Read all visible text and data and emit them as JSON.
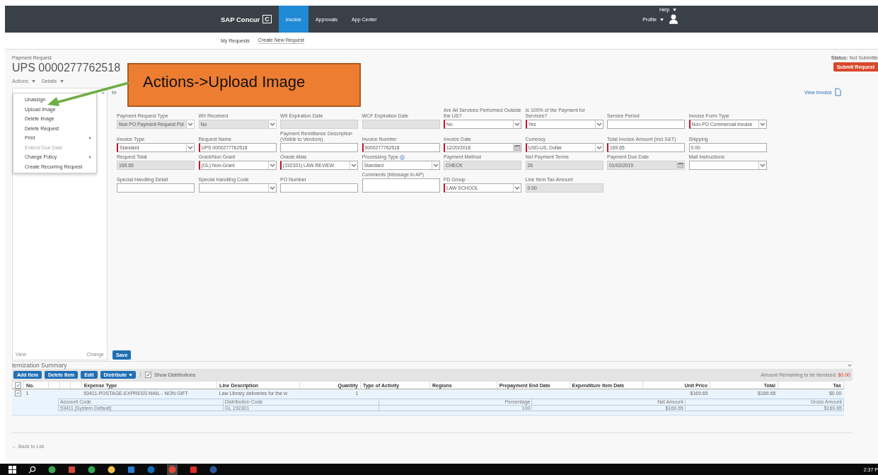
{
  "nav": {
    "brand": "SAP Concur",
    "brand_mark": "C",
    "help": "Help",
    "profile": "Profile",
    "tabs": [
      {
        "label": "Invoice",
        "selected": true
      },
      {
        "label": "Approvals",
        "selected": false
      },
      {
        "label": "App Center",
        "selected": false
      }
    ]
  },
  "subnav": [
    {
      "label": "My Requests",
      "selected": false
    },
    {
      "label": "Create New Request",
      "selected": true
    }
  ],
  "header": {
    "kicker": "Payment Request",
    "title": "UPS 0000277762518",
    "status_label": "Status:",
    "status_value": "Not Submitte",
    "submit": "Submit Request"
  },
  "menus": [
    "Actions",
    "Details"
  ],
  "actions_menu": [
    {
      "label": "Unassign",
      "disabled": false,
      "submenu": false
    },
    {
      "label": "Upload Image",
      "disabled": false,
      "submenu": false
    },
    {
      "label": "Delete Image",
      "disabled": false,
      "submenu": false
    },
    {
      "label": "Delete Request",
      "disabled": false,
      "submenu": false
    },
    {
      "label": "Print",
      "disabled": false,
      "submenu": true
    },
    {
      "label": "Extend Due Date",
      "disabled": true,
      "submenu": false
    },
    {
      "label": "Change Policy",
      "disabled": false,
      "submenu": true
    },
    {
      "label": "Create Recurring Request",
      "disabled": false,
      "submenu": false
    }
  ],
  "panel": {
    "collapse": "«",
    "view": "View",
    "change": "Change"
  },
  "form_tab": "In",
  "view_invoice": "View Invoice",
  "form_rows": [
    [
      {
        "label": "Payment Request Type",
        "kind": "select",
        "value": "Non PO Payment Request Pol",
        "required": false,
        "disabled": true
      },
      {
        "label": "W9 Received",
        "kind": "select",
        "value": "No",
        "required": false,
        "disabled": true
      },
      {
        "label": "W9 Expiration Date",
        "kind": "text",
        "required": false,
        "disabled": true
      },
      {
        "label": "WCF Expiration Date",
        "kind": "text",
        "required": false,
        "disabled": true
      },
      {
        "label": "Are All Services Performed Outside the US?",
        "kind": "select",
        "value": "No",
        "required": true,
        "disabled": false
      },
      {
        "label": "Is 100% of the Payment for Services?",
        "kind": "select",
        "value": "Yes",
        "required": true,
        "disabled": false
      },
      {
        "label": "Service Period",
        "kind": "text",
        "required": false,
        "disabled": false
      },
      {
        "label": "Invoice Form Type",
        "kind": "select",
        "value": "Non-PO Commercial Invoice",
        "required": true,
        "disabled": false
      }
    ],
    [
      {
        "label": "Invoice Type",
        "kind": "select",
        "value": "Standard",
        "required": true,
        "disabled": false
      },
      {
        "label": "Request Name",
        "kind": "text",
        "value": "UPS 0000277762518",
        "required": true,
        "disabled": false
      },
      {
        "label": "Payment Remittance Description (Visible to Vendors)",
        "kind": "text",
        "required": false,
        "disabled": false
      },
      {
        "label": "Invoice Number",
        "kind": "text",
        "value": "0000277762518",
        "required": true,
        "disabled": false
      },
      {
        "label": "Invoice Date",
        "kind": "date",
        "value": "12/20/2018",
        "required": true,
        "disabled": false
      },
      {
        "label": "Currency",
        "kind": "select",
        "value": "USD-US, Dollar",
        "required": true,
        "disabled": false
      },
      {
        "label": "Total Invoice Amount (incl S&T)",
        "kind": "text",
        "value": "169.65",
        "required": true,
        "disabled": false
      },
      {
        "label": "Shipping",
        "kind": "text",
        "value": "0.00",
        "required": false,
        "disabled": false
      }
    ],
    [
      {
        "label": "Request Total",
        "kind": "text",
        "value": "169.65",
        "required": false,
        "disabled": true
      },
      {
        "label": "Grant/Non Grant",
        "kind": "select",
        "value": "(GL) Non-Grant",
        "required": true,
        "disabled": false
      },
      {
        "label": "Oracle Alias",
        "kind": "select",
        "value": "(192301) LAW REVIEW",
        "required": true,
        "disabled": false
      },
      {
        "label": "Processing Type",
        "info": true,
        "kind": "select",
        "value": "Standard",
        "required": false,
        "disabled": false
      },
      {
        "label": "Payment Method",
        "kind": "text",
        "value": "CHECK",
        "required": false,
        "disabled": true
      },
      {
        "label": "Net Payment Terms",
        "kind": "text",
        "value": "26",
        "required": false,
        "disabled": true
      },
      {
        "label": "Payment Due Date",
        "kind": "date",
        "value": "01/02/2019",
        "required": false,
        "disabled": true
      },
      {
        "label": "Mail Instructions",
        "kind": "select",
        "required": false,
        "disabled": false
      }
    ],
    [
      {
        "label": "Special Handling Detail",
        "kind": "text",
        "required": false,
        "disabled": false
      },
      {
        "label": "Special Handling Code",
        "kind": "select",
        "required": false,
        "disabled": false
      },
      {
        "label": "PO Number",
        "kind": "text",
        "required": false,
        "disabled": false
      },
      {
        "label": "Comments (Message to AP)",
        "kind": "textarea",
        "required": false,
        "disabled": false
      },
      {
        "label": "FD Group",
        "kind": "select",
        "value": "LAW SCHOOL",
        "required": true,
        "disabled": false
      },
      {
        "label": "Line Item Tax Amount",
        "kind": "text",
        "value": "0.00",
        "required": false,
        "disabled": true
      }
    ]
  ],
  "save": "Save",
  "itemization": {
    "title": "temization Summary",
    "buttons": [
      {
        "label": "Add Item",
        "caret": false
      },
      {
        "label": "Delete Item",
        "caret": false
      },
      {
        "label": "Edit",
        "caret": false
      },
      {
        "label": "Distribute",
        "caret": true
      }
    ],
    "show_distributions": {
      "label": "Show Distributions",
      "checked": true
    },
    "remaining_label": "Amount Remaining to be Itemized:",
    "remaining_value": "$0.00"
  },
  "table": {
    "all_checked": true,
    "columns": [
      "No.",
      "Expense Type",
      "Line Description",
      "Quantity",
      "Type of Activity",
      "Regions",
      "Prepayment End Date",
      "Expenditure Item Date",
      "Unit Price",
      "Total",
      "Tax"
    ],
    "rows": [
      {
        "checked": true,
        "cells": [
          "1",
          "53411-POSTAGE-EXPRESS MAIL - NON GIFT",
          "Law Library deliveries for the w",
          "1",
          null,
          null,
          null,
          null,
          "$169.65",
          "$169.65",
          "$0.00"
        ]
      }
    ]
  },
  "distribution": {
    "columns": [
      "Account Code",
      "Distribution Code",
      "Percentage",
      "Net Amount",
      "Gross Amount"
    ],
    "rows": [
      [
        "53411 [System Default]",
        "GL 192301",
        "100",
        "$169.65",
        "$169.65"
      ]
    ]
  },
  "back": "← Back to List",
  "callout": "Actions->Upload Image",
  "clock": "2:37 P"
}
